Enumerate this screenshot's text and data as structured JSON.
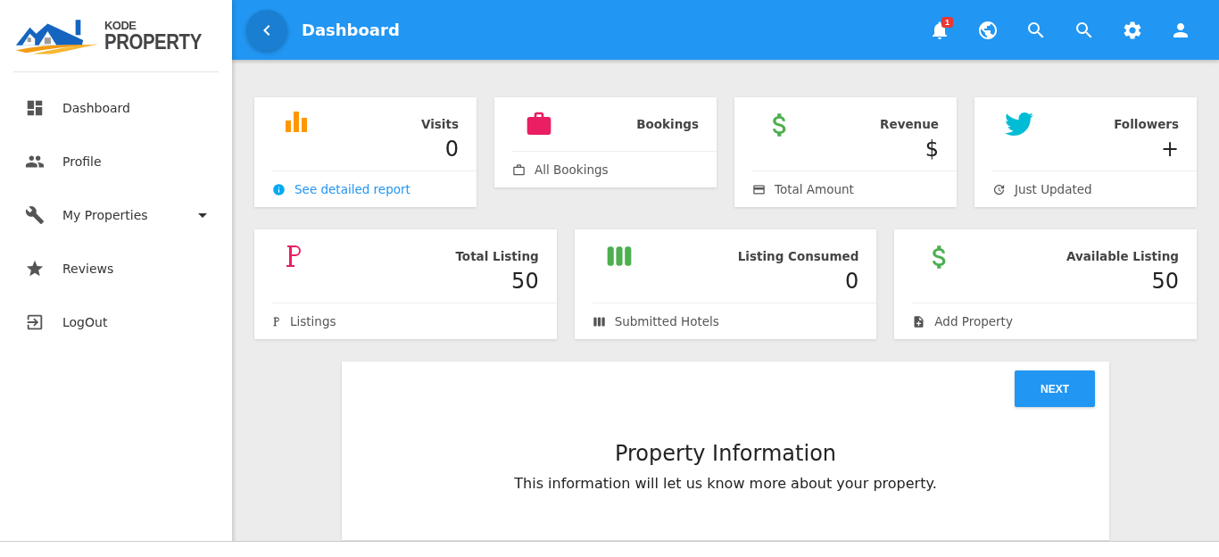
{
  "logo": {
    "line_1": "KODE",
    "line_2": "PROPERTY"
  },
  "sidebar": {
    "items": [
      {
        "label": "Dashboard"
      },
      {
        "label": "Profile"
      },
      {
        "label": "My Properties",
        "expanded": false
      },
      {
        "label": "Reviews"
      },
      {
        "label": "LogOut"
      }
    ]
  },
  "header": {
    "title": "Dashboard",
    "notification_count": "1"
  },
  "stats_row_1": [
    {
      "title": "Visits",
      "value": "0",
      "footer": "See detailed report",
      "footer_link": true,
      "color": "#ff9800"
    },
    {
      "title": "Bookings",
      "footer": "All Bookings",
      "footer_link": false,
      "color": "#e91e63"
    },
    {
      "title": "Revenue",
      "value": "$",
      "footer": "Total Amount",
      "footer_link": false,
      "color": "#4caf50"
    },
    {
      "title": "Followers",
      "value": "+",
      "footer": "Just Updated",
      "footer_link": false,
      "color": "#00bcd4"
    }
  ],
  "stats_row_2": [
    {
      "title": "Total Listing",
      "value": "50",
      "footer": "Listings",
      "color": "#e91e63"
    },
    {
      "title": "Listing Consumed",
      "value": "0",
      "footer": "Submitted Hotels",
      "color": "#4caf50"
    },
    {
      "title": "Available Listing",
      "value": "50",
      "footer": "Add Property",
      "color": "#4caf50"
    }
  ],
  "wizard": {
    "next_button": "NEXT",
    "title": "Property Information",
    "subtitle": "This information will let us know more about your property."
  }
}
